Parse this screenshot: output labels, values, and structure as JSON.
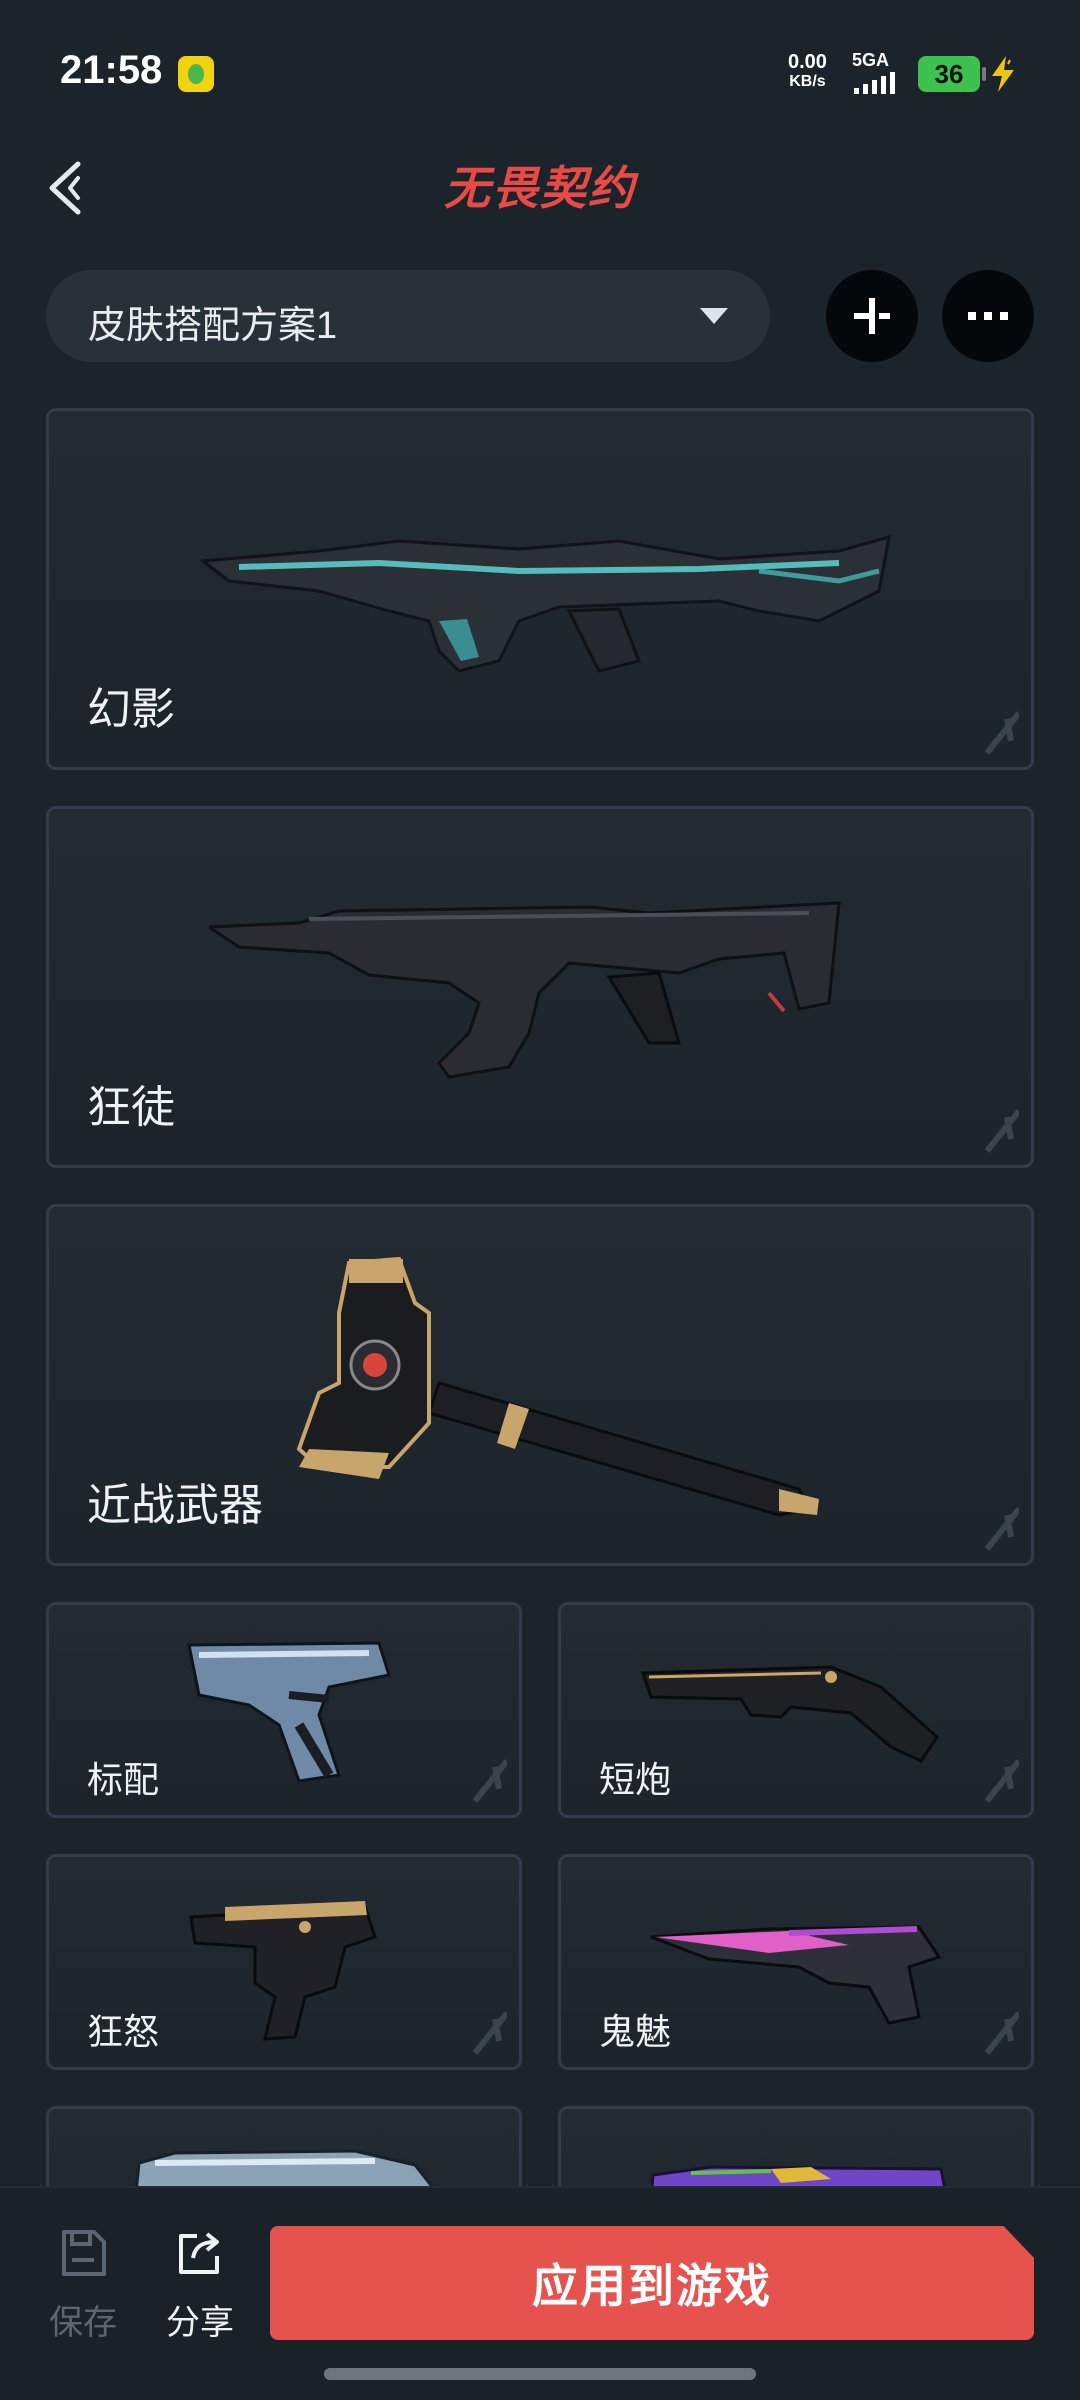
{
  "status": {
    "time": "21:58",
    "net_speed_value": "0.00",
    "net_speed_unit": "KB/s",
    "signal_label": "5GA",
    "battery": "36",
    "app_icon": "qq-music-icon",
    "charging_icon": "charging-bolt-icon"
  },
  "header": {
    "back_icon": "back-arrow-icon",
    "logo_text": "无畏契约",
    "accent": "#e94a45"
  },
  "plan": {
    "name": "皮肤搭配方案1",
    "dropdown_icon": "caret-down-icon",
    "add_icon": "plus-icon",
    "more_icon": "more-dots-icon"
  },
  "weapons": [
    {
      "name": "幻影"
    },
    {
      "name": "狂徒"
    },
    {
      "name": "近战武器"
    },
    {
      "name": "标配"
    },
    {
      "name": "短炮"
    },
    {
      "name": "狂怒"
    },
    {
      "name": "鬼魅"
    },
    {
      "name": ""
    },
    {
      "name": ""
    }
  ],
  "bottom": {
    "save_label": "保存",
    "share_label": "分享",
    "apply_label": "应用到游戏",
    "apply_color": "#e6534f"
  }
}
